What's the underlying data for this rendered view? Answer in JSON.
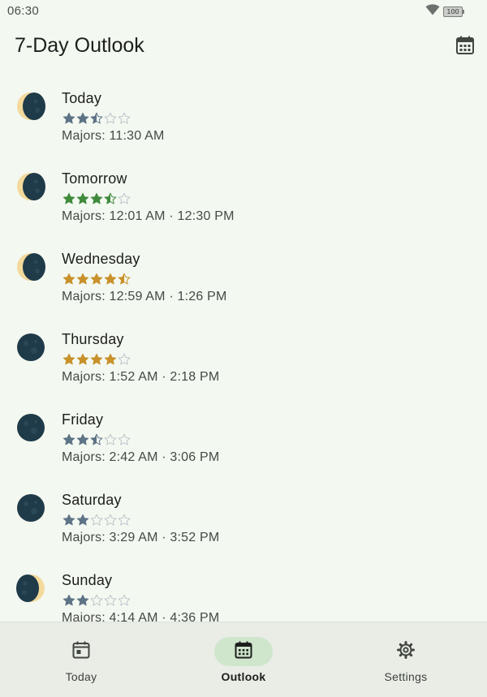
{
  "status_bar": {
    "time": "06:30",
    "battery": "100",
    "wifi_icon": "wifi-icon"
  },
  "app_bar": {
    "title": "7-Day Outlook",
    "action_icon": "calendar-icon"
  },
  "colors": {
    "background": "#f3f8f1",
    "star_blue": "#5d7386",
    "star_green": "#3f8b3b",
    "star_gold": "#c8912a",
    "moon_dark": "#1f3a48",
    "moon_light": "#f3d99c",
    "nav_active_pill": "#cfe6cd"
  },
  "days": [
    {
      "name": "Today",
      "rating": 2.5,
      "star_color": "#5d7386",
      "moon_phase": "waxing-crescent",
      "majors": "Majors: 11:30 AM"
    },
    {
      "name": "Tomorrow",
      "rating": 3.5,
      "star_color": "#3f8b3b",
      "moon_phase": "waxing-crescent",
      "majors": "Majors: 12:01 AM · 12:30 PM"
    },
    {
      "name": "Wednesday",
      "rating": 4.5,
      "star_color": "#c8912a",
      "moon_phase": "waxing-crescent",
      "majors": "Majors: 12:59 AM · 1:26 PM"
    },
    {
      "name": "Thursday",
      "rating": 4,
      "star_color": "#c8912a",
      "moon_phase": "new-moon",
      "majors": "Majors: 1:52 AM · 2:18 PM"
    },
    {
      "name": "Friday",
      "rating": 2.5,
      "star_color": "#5d7386",
      "moon_phase": "new-moon",
      "majors": "Majors: 2:42 AM · 3:06 PM"
    },
    {
      "name": "Saturday",
      "rating": 2,
      "star_color": "#5d7386",
      "moon_phase": "new-moon",
      "majors": "Majors: 3:29 AM · 3:52 PM"
    },
    {
      "name": "Sunday",
      "rating": 2,
      "star_color": "#5d7386",
      "moon_phase": "waning-crescent",
      "majors": "Majors: 4:14 AM · 4:36 PM"
    }
  ],
  "nav": {
    "active": "Outlook",
    "items": [
      {
        "label": "Today",
        "icon": "calendar-today-icon"
      },
      {
        "label": "Outlook",
        "icon": "calendar-month-icon"
      },
      {
        "label": "Settings",
        "icon": "gear-icon"
      }
    ]
  }
}
